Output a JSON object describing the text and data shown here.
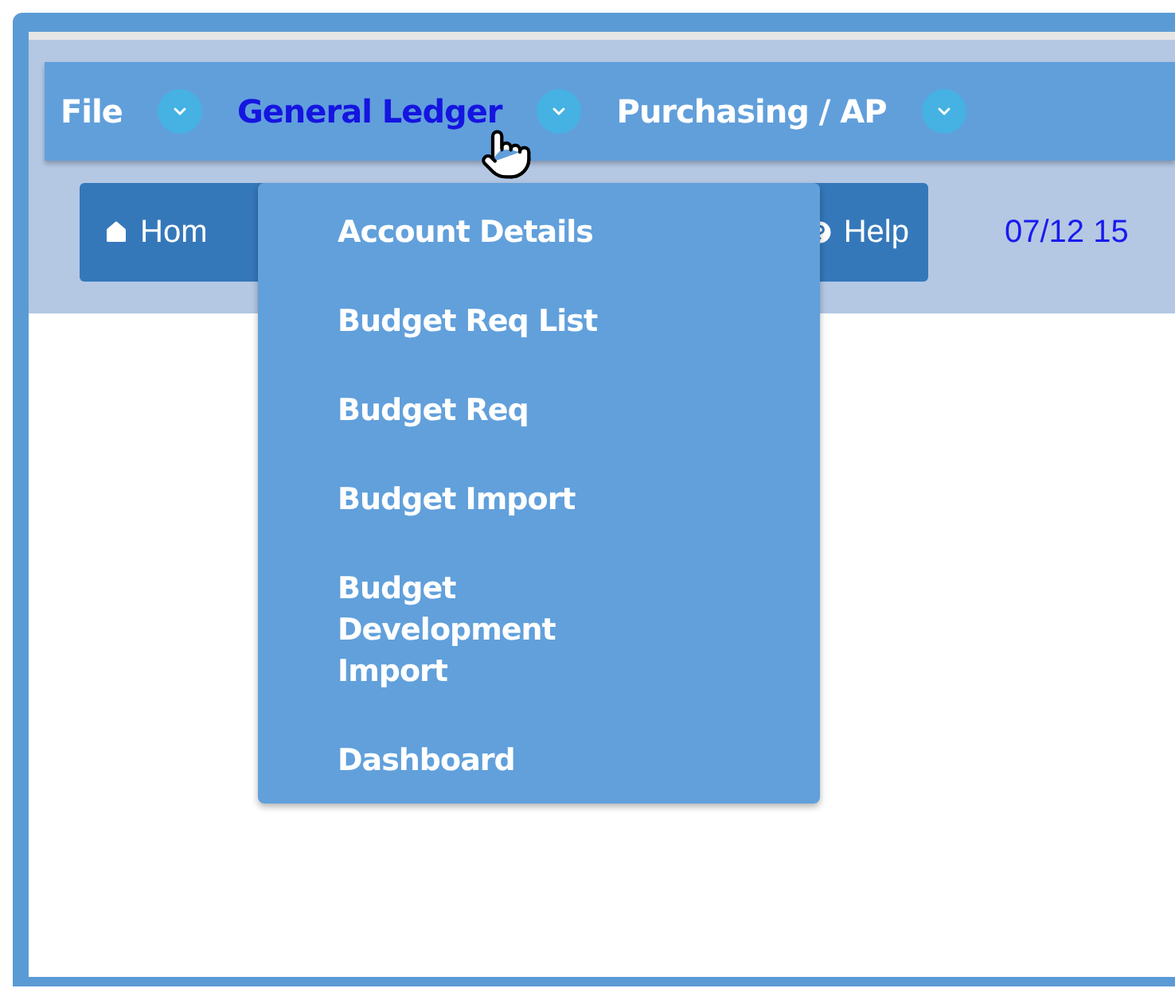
{
  "menubar": {
    "items": [
      {
        "label": "File",
        "selected": false
      },
      {
        "label": "General Ledger",
        "selected": true
      },
      {
        "label": "Purchasing / AP",
        "selected": false
      }
    ]
  },
  "toolbar": {
    "buttons": [
      {
        "kind": "home",
        "label": "Hom"
      },
      {
        "kind": "help",
        "label": "Help"
      }
    ],
    "timestamp": "07/12 15"
  },
  "dropdown": {
    "items": [
      "Account Details",
      "Budget Req List",
      "Budget Req",
      "Budget Import",
      "Budget Development Import",
      "Dashboard"
    ]
  }
}
